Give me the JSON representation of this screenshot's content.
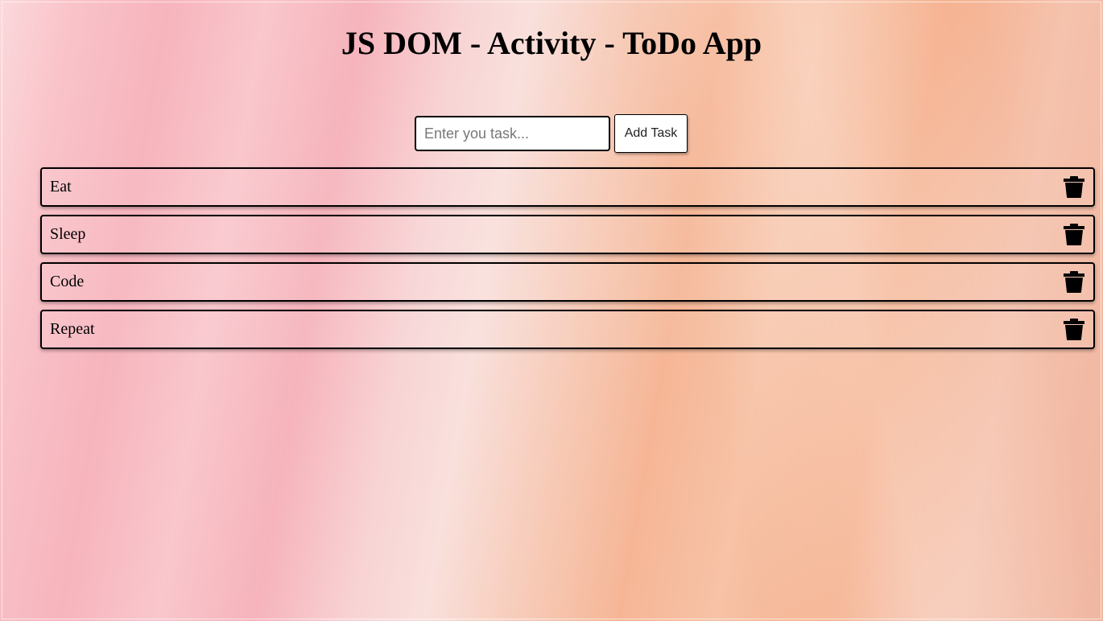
{
  "page": {
    "title": "JS DOM - Activity - ToDo App"
  },
  "form": {
    "input_value": "",
    "input_placeholder": "Enter you task...",
    "add_button_label": "Add Task"
  },
  "tasks": [
    {
      "label": "Eat",
      "action_icon": "trash-icon"
    },
    {
      "label": "Sleep",
      "action_icon": "trash-icon"
    },
    {
      "label": "Code",
      "action_icon": "trash-icon"
    },
    {
      "label": "Repeat",
      "action_icon": "trash-icon"
    }
  ],
  "colors": {
    "text": "#000000",
    "border": "#000000",
    "input_background": "#ffffff",
    "background_pink": "#f7b4bd",
    "background_peach": "#f6b696"
  }
}
